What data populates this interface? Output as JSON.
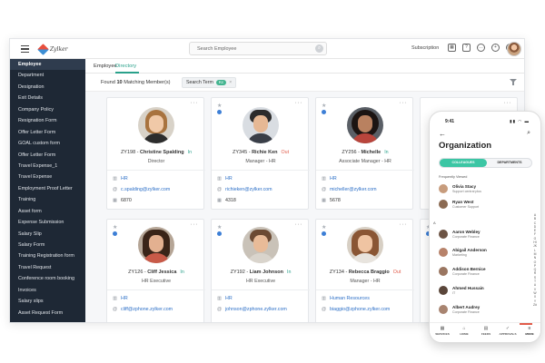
{
  "app": {
    "logo_text": "Zylker",
    "search_placeholder": "Search Employee",
    "subscription": "Subscription"
  },
  "topbar_icons": [
    "calendar-icon",
    "help-icon",
    "chat-icon",
    "add-icon",
    "bell-icon"
  ],
  "sidebar": {
    "items": [
      {
        "label": "Employee",
        "active": true
      },
      {
        "label": "Department"
      },
      {
        "label": "Designation"
      },
      {
        "label": "Exit Details"
      },
      {
        "label": "Company Policy"
      },
      {
        "label": "Resignation Form"
      },
      {
        "label": "Offer Letter Form"
      },
      {
        "label": "GOAL custom form"
      },
      {
        "label": "Offer Letter Form"
      },
      {
        "label": "Travel Expense_1"
      },
      {
        "label": "Travel Expense"
      },
      {
        "label": "Employment Proof Letter"
      },
      {
        "label": "Training"
      },
      {
        "label": "Asset form"
      },
      {
        "label": "Expense Submission"
      },
      {
        "label": "Salary Slip"
      },
      {
        "label": "Salary Form"
      },
      {
        "label": "Training Registration form"
      },
      {
        "label": "Travel Request"
      },
      {
        "label": "Conference room booking"
      },
      {
        "label": "Invoices"
      },
      {
        "label": "Salary slips"
      },
      {
        "label": "Asset Request Form"
      }
    ]
  },
  "tabs": [
    {
      "label": "Employee"
    },
    {
      "label": "Directory",
      "active": true
    }
  ],
  "filter": {
    "found_prefix": "Found",
    "found_count": "10",
    "found_suffix": "Matching Member(s)",
    "chip_label": "Search Term",
    "chip_badge": "Kc",
    "chip_close": "×"
  },
  "cards": [
    {
      "id": "ZY198",
      "name": "Christine Spalding",
      "status": "In",
      "role": "Director",
      "dept": "HR",
      "email": "c.spalding@zylker.com",
      "ext": "6870"
    },
    {
      "id": "ZY345",
      "name": "Richie Ken",
      "status": "Out",
      "role": "Manager - HR",
      "dept": "HR",
      "email": "richieken@zylker.com",
      "ext": "4318"
    },
    {
      "id": "ZY256",
      "name": "Michelle",
      "status": "In",
      "role": "Associate  Manager - HR",
      "dept": "HR",
      "email": "micheller@zylker.com",
      "ext": "5678"
    },
    {
      "id": "ZY126",
      "name": "Cliff Jessica",
      "status": "In",
      "role": "HR Executive",
      "dept": "HR",
      "email": "cliff@zphone.zylker.com"
    },
    {
      "id": "ZY192",
      "name": "Liam Johnson",
      "status": "In",
      "role": "HR Executive",
      "dept": "HR",
      "email": "johnson@zphone.zylker.com"
    },
    {
      "id": "ZY134",
      "name": "Rebecca Braggio",
      "status": "Out",
      "role": "Manager - HR",
      "dept": "Human Resources",
      "email": "biaggio@zphone.zylker.com"
    }
  ],
  "phone": {
    "time": "9:41",
    "status_icons": "▮▮ ◠ ▬",
    "title": "Organization",
    "seg_on": "COLLEAGUES",
    "seg_off": "DEPARTMENTS",
    "section": "Frequently Viewed",
    "people": [
      {
        "name": "Olivia Stacy",
        "title": "Support central plus"
      },
      {
        "name": "Ryan West",
        "title": "Customer Support"
      },
      {
        "name": "Aaron Webley",
        "title": "Corporate Finance"
      },
      {
        "name": "Abigail Anderson",
        "title": "Marketing"
      },
      {
        "name": "Addison Bernice",
        "title": "Corporate Finance"
      },
      {
        "name": "Ahmed Hussain",
        "title": "IT"
      },
      {
        "name": "Albert Audrey",
        "title": "Corporate Finance"
      }
    ],
    "letter": "A",
    "alphabet": "ABCDEFGHIJKLMNOPQRSTUVWXYZ#",
    "nav": [
      {
        "label": "SERVICES",
        "icon": "▦"
      },
      {
        "label": "HOME",
        "icon": "⌂"
      },
      {
        "label": "FEEDS",
        "icon": "▤"
      },
      {
        "label": "APPROVALS",
        "icon": "✓"
      },
      {
        "label": "MORE",
        "icon": "≡",
        "active": true
      }
    ]
  }
}
